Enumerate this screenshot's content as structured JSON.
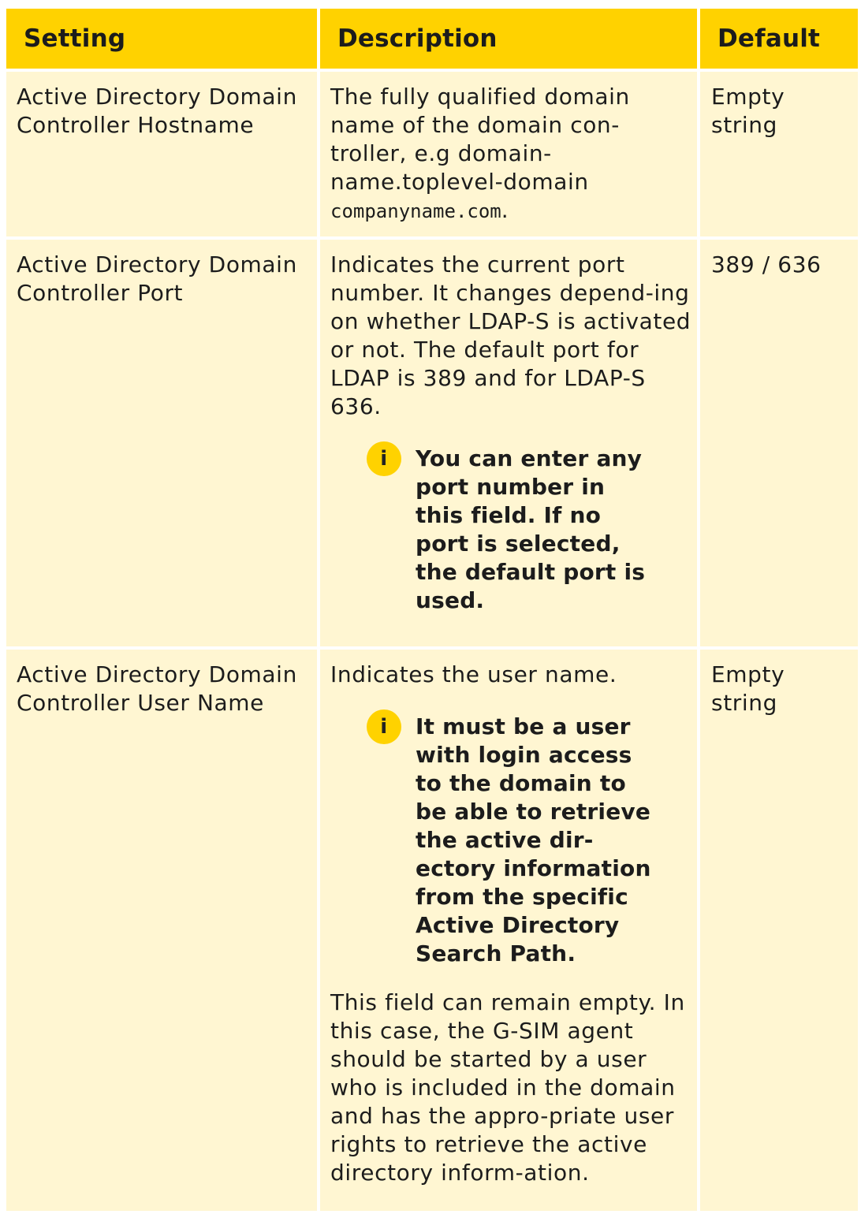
{
  "header": {
    "setting": "Setting",
    "description": "Description",
    "default": "Default"
  },
  "rows": [
    {
      "setting": "Active Directory Domain Controller Hostname",
      "description_prefix": "The fully qualified domain name of the domain con-troller, e.g domain-name.toplevel-domain",
      "description_code": "companyname.com",
      "description_suffix": ".",
      "default": "Empty string"
    },
    {
      "setting": "Active Directory Domain Controller Port",
      "description": "Indicates the current port number. It changes depend-ing on whether LDAP-S is activated or not. The default port for LDAP is 389 and for LDAP-S 636.",
      "note_icon": "i",
      "note": "You can enter any port number in this field. If no port is selected, the default port is used.",
      "default": "389 / 636"
    },
    {
      "setting": "Active Directory Domain Controller User Name",
      "description": "Indicates the user name.",
      "note_icon": "i",
      "note": "It must be a user with login access to the domain to be able to retrieve the active dir-ectory information from the specific Active Directory Search Path.",
      "description_after": "This field can remain empty. In this case, the G-SIM agent should be started by a user who is included in the domain and has the appro-priate user rights to retrieve the active directory inform-ation.",
      "default": "Empty string"
    }
  ],
  "colors": {
    "header_bg": "#ffd200",
    "cell_bg": "#fff6d2",
    "icon_bg": "#ffd200"
  },
  "icons": {
    "note": "info-icon"
  }
}
